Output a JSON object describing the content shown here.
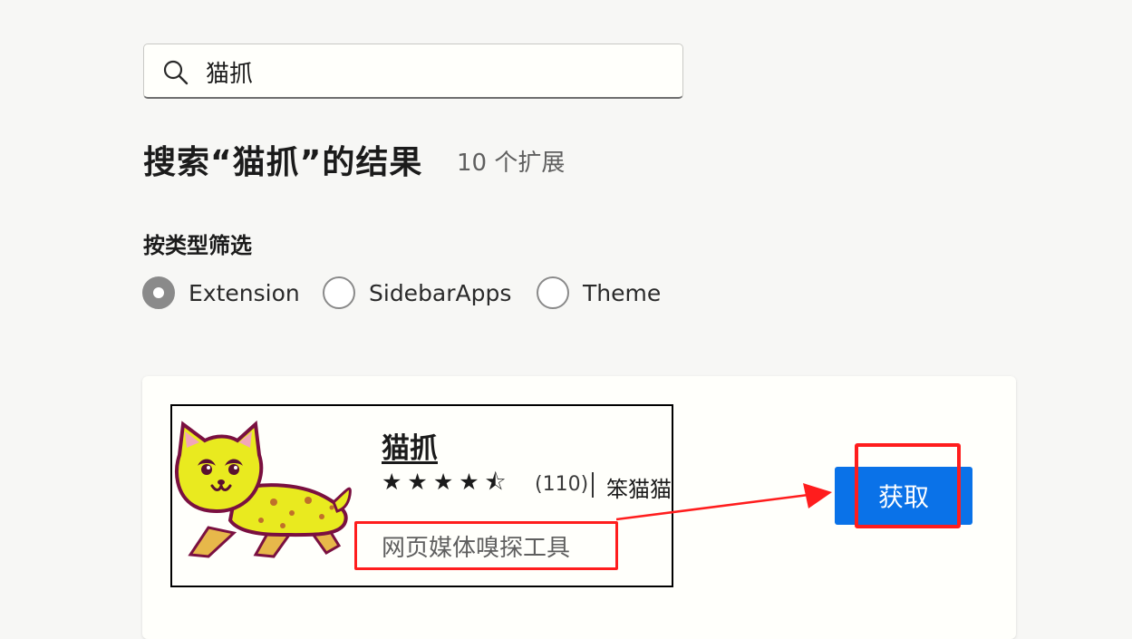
{
  "search": {
    "value": "猫抓",
    "icon": "search-icon"
  },
  "results": {
    "title": "搜索“猫抓”的结果",
    "count": "10 个扩展"
  },
  "filter": {
    "heading": "按类型筛选",
    "options": [
      {
        "label": "Extension",
        "selected": true
      },
      {
        "label": "SidebarApps",
        "selected": false
      },
      {
        "label": "Theme",
        "selected": false
      }
    ]
  },
  "extension": {
    "name": "猫抓",
    "rating": 4.5,
    "rating_count": "(110)",
    "publisher": "笨猫猫",
    "description": "网页媒体嗅探工具",
    "get_label": "获取",
    "icon": "cat-grab-icon"
  },
  "colors": {
    "accent": "#0a72e8",
    "annotation": "#ff1d1d",
    "background": "#f7f7f5"
  }
}
